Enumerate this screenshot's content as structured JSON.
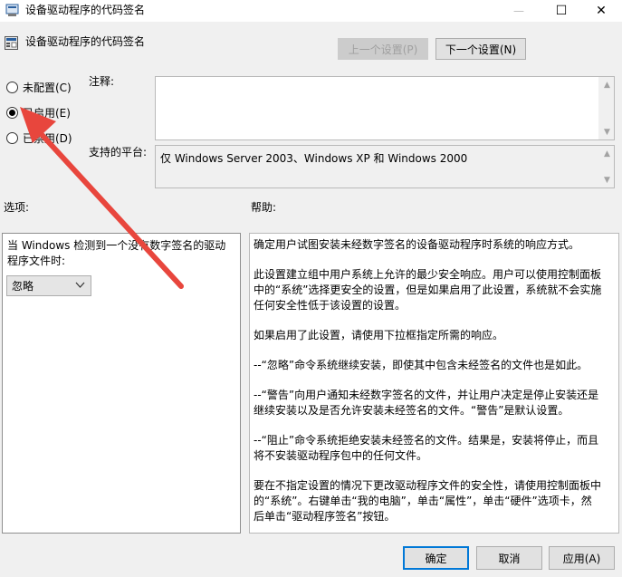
{
  "window": {
    "title": "设备驱动程序的代码签名",
    "controls": {
      "minimize": "—",
      "maximize": "☐",
      "close": "✕"
    }
  },
  "header": {
    "setting_name": "设备驱动程序的代码签名",
    "prev_label": "上一个设置(P)",
    "next_label": "下一个设置(N)"
  },
  "state": {
    "options": [
      {
        "label": "未配置(C)",
        "checked": false
      },
      {
        "label": "已启用(E)",
        "checked": true
      },
      {
        "label": "已禁用(D)",
        "checked": false
      }
    ]
  },
  "comment": {
    "label": "注释:",
    "value": ""
  },
  "platform": {
    "label": "支持的平台:",
    "value": "仅 Windows Server 2003、Windows XP 和 Windows 2000"
  },
  "options_pane": {
    "title": "选项:",
    "description": "当 Windows 检测到一个没有数字签名的驱动程序文件时:",
    "select_value": "忽略"
  },
  "help_pane": {
    "title": "帮助:",
    "paragraphs": [
      "确定用户试图安装未经数字签名的设备驱动程序时系统的响应方式。",
      "此设置建立组中用户系统上允许的最少安全响应。用户可以使用控制面板中的“系统”选择更安全的设置，但是如果启用了此设置，系统就不会实施任何安全性低于该设置的设置。",
      "如果启用了此设置，请使用下拉框指定所需的响应。",
      "--“忽略”命令系统继续安装，即使其中包含未经签名的文件也是如此。",
      "--“警告”向用户通知未经数字签名的文件，并让用户决定是停止安装还是继续安装以及是否允许安装未经签名的文件。“警告”是默认设置。",
      "--“阻止”命令系统拒绝安装未经签名的文件。结果是，安装将停止，而且将不安装驱动程序包中的任何文件。",
      "要在不指定设置的情况下更改驱动程序文件的安全性，请使用控制面板中的“系统”。右键单击“我的电脑”，单击“属性”，单击“硬件”选项卡，然后单击“驱动程序签名”按钮。"
    ]
  },
  "footer": {
    "ok_label": "确定",
    "cancel_label": "取消",
    "apply_label": "应用(A)"
  },
  "colors": {
    "annotation_arrow": "#e8463d",
    "default_button_border": "#0078d7"
  }
}
